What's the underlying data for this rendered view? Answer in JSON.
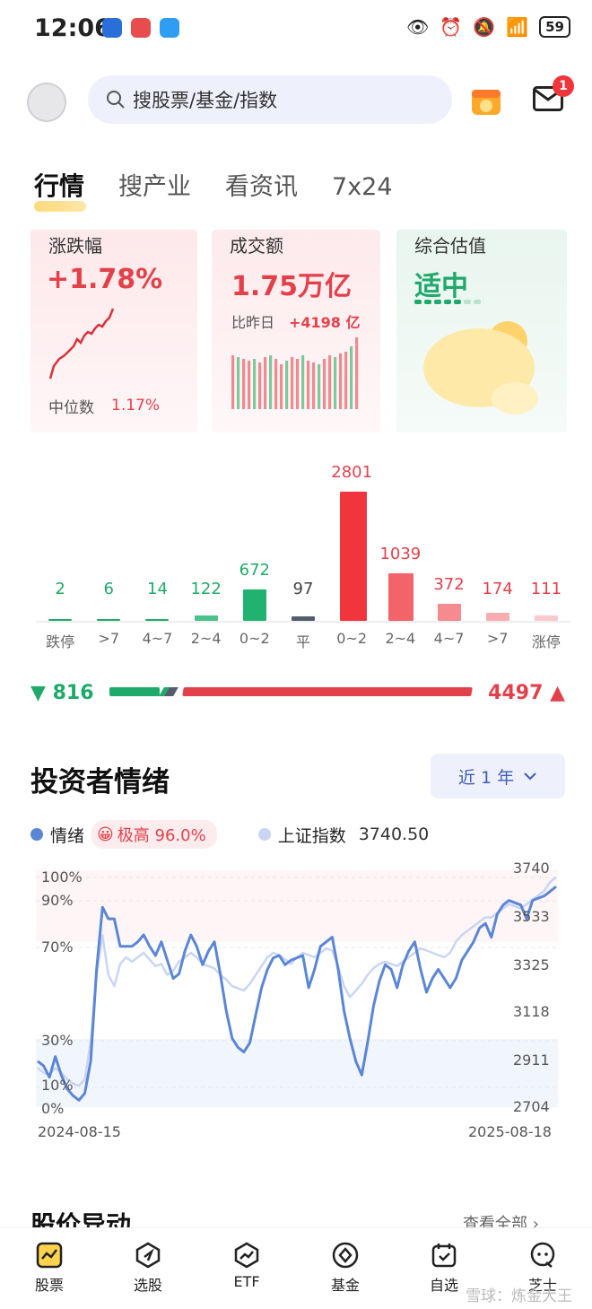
{
  "status": {
    "time": "12:06",
    "battery": "59"
  },
  "header": {
    "search_placeholder": "搜股票/基金/指数",
    "mail_badge": "1"
  },
  "tabs": [
    {
      "label": "行情",
      "active": true
    },
    {
      "label": "搜产业",
      "active": false
    },
    {
      "label": "看资讯",
      "active": false
    },
    {
      "label": "7x24",
      "active": false
    }
  ],
  "cards": {
    "change": {
      "title": "涨跌幅",
      "value": "+1.78%",
      "median_label": "中位数",
      "median_value": "1.17%"
    },
    "turnover": {
      "title": "成交额",
      "value": "1.75万亿",
      "compare_label": "比昨日",
      "compare_value": "+4198 亿"
    },
    "valuation": {
      "title": "综合估值",
      "value": "适中"
    }
  },
  "distribution": {
    "categories": [
      "跌停",
      ">7",
      "4~7",
      "2~4",
      "0~2",
      "平",
      "0~2",
      "2~4",
      "4~7",
      ">7",
      "涨停"
    ],
    "values": [
      2,
      6,
      14,
      122,
      672,
      97,
      2801,
      1039,
      372,
      174,
      111
    ],
    "colors": [
      "#1faa6b",
      "#1faa6b",
      "#1faa6b",
      "#4cc08a",
      "#1fb36f",
      "#555d6b",
      "#f0353d",
      "#f2636a",
      "#f58a8f",
      "#f8aeb1",
      "#fbc9cb"
    ],
    "down_total": "816",
    "up_total": "4497"
  },
  "sentiment": {
    "title": "投资者情绪",
    "range": "近 1 年",
    "legend_sentiment": "情绪",
    "sentiment_status": "极高 96.0%",
    "legend_index": "上证指数",
    "index_value": "3740.50",
    "y_left": [
      "100%",
      "90%",
      "70%",
      "30%",
      "10%",
      "0%"
    ],
    "y_right": [
      "3740",
      "3533",
      "3325",
      "3118",
      "2911",
      "2704"
    ],
    "x_start": "2024-08-15",
    "x_end": "2025-08-18"
  },
  "chart_data": {
    "type": "line",
    "x": [
      "2024-08-15",
      "2025-08-18"
    ],
    "series": [
      {
        "name": "情绪",
        "color": "#5b86d6",
        "values": [
          20,
          18,
          13,
          22,
          14,
          8,
          5,
          3,
          6,
          20,
          60,
          87,
          82,
          82,
          70,
          70,
          70,
          72,
          75,
          70,
          66,
          72,
          64,
          56,
          58,
          68,
          75,
          70,
          62,
          68,
          72,
          58,
          42,
          30,
          26,
          24,
          28,
          40,
          52,
          60,
          65,
          66,
          62,
          64,
          65,
          66,
          52,
          60,
          70,
          72,
          74,
          60,
          42,
          30,
          20,
          14,
          28,
          44,
          55,
          62,
          60,
          52,
          62,
          68,
          72,
          60,
          50,
          56,
          60,
          56,
          52,
          56,
          64,
          68,
          72,
          78,
          80,
          74,
          84,
          88,
          90,
          89,
          88,
          82,
          90,
          91,
          92,
          94,
          96
        ]
      },
      {
        "name": "上证指数",
        "color": "#c9d5f3",
        "values": [
          2880,
          2860,
          2850,
          2880,
          2860,
          2830,
          2810,
          2800,
          2830,
          3000,
          3300,
          3480,
          3300,
          3250,
          3350,
          3380,
          3360,
          3380,
          3400,
          3370,
          3340,
          3350,
          3300,
          3320,
          3360,
          3380,
          3400,
          3380,
          3350,
          3340,
          3330,
          3300,
          3280,
          3250,
          3240,
          3230,
          3260,
          3300,
          3340,
          3380,
          3400,
          3390,
          3370,
          3350,
          3380,
          3400,
          3390,
          3380,
          3400,
          3420,
          3410,
          3340,
          3250,
          3200,
          3230,
          3260,
          3300,
          3330,
          3350,
          3360,
          3350,
          3340,
          3360,
          3380,
          3400,
          3420,
          3410,
          3400,
          3390,
          3380,
          3400,
          3450,
          3480,
          3500,
          3520,
          3540,
          3560,
          3560,
          3580,
          3600,
          3620,
          3610,
          3600,
          3620,
          3640,
          3660,
          3680,
          3720,
          3740
        ]
      }
    ],
    "ylim_left": [
      0,
      100
    ],
    "ylim_right": [
      2704,
      3740
    ]
  },
  "bottom": {
    "section_title": "股价异动",
    "see_all": "查看全部"
  },
  "nav": [
    {
      "label": "股票",
      "icon": "stock-chart-icon"
    },
    {
      "label": "选股",
      "icon": "compass-icon"
    },
    {
      "label": "ETF",
      "icon": "trend-icon"
    },
    {
      "label": "基金",
      "icon": "fund-icon"
    },
    {
      "label": "自选",
      "icon": "calendar-check-icon"
    },
    {
      "label": "芝士",
      "icon": "chat-icon"
    }
  ],
  "watermark": "雪球：炼金大王"
}
